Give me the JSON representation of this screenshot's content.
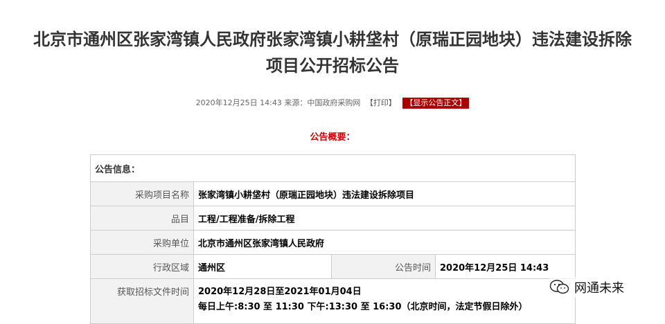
{
  "title": {
    "line1": "北京市通州区张家湾镇人民政府张家湾镇小耕垡村（原瑞正园地块）违法建设拆除",
    "line2": "项目公开招标公告"
  },
  "meta": {
    "date_source": "2020年12月25日 14:43 来源：中国政府采购网",
    "print_label": "【打印】",
    "show_text_label": "【显示公告正文】"
  },
  "summary_title": "公告概要：",
  "table": {
    "section_label": "公告信息：",
    "project_name_label": "采购项目名称",
    "project_name_value": "张家湾镇小耕垡村（原瑞正园地块）违法建设拆除项目",
    "category_label": "品目",
    "category_value": "工程/工程准备/拆除工程",
    "purchaser_label": "采购单位",
    "purchaser_value": "北京市通州区张家湾镇人民政府",
    "region_label": "行政区域",
    "region_value": "通州区",
    "announce_time_label": "公告时间",
    "announce_time_value": "2020年12月25日 14:43",
    "doc_time_label": "获取招标文件时间",
    "doc_time_value_line1": "2020年12月28日至2021年01月04日",
    "doc_time_value_line2": "每日上午:8:30 至 11:30  下午:13:30 至 16:30（北京时间，法定节假日除外）"
  },
  "watermark": {
    "text": "网通未来",
    "icon": "wechat-icon"
  },
  "colors": {
    "accent_red": "#cc0000",
    "button_red": "#aa0000",
    "label_bg": "#f2f2f2",
    "border": "#cccccc"
  }
}
